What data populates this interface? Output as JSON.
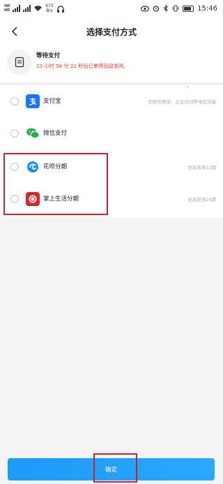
{
  "status_bar": {
    "sim1": "HD",
    "sim2": "HD",
    "speed_value": "675",
    "speed_unit": "B/s",
    "battery": "",
    "time": "15:46"
  },
  "nav": {
    "back_label": "‹",
    "title": "选择支付方式"
  },
  "order": {
    "title": "等待支付",
    "countdown": "23 小时 58 分 21 秒后订单将自动关闭。"
  },
  "payment_methods": [
    {
      "name": "支付宝",
      "tip": "勿轻信刷单、企业代付等电信诈骗",
      "icon": "alipay-icon",
      "color": "#1677ff"
    },
    {
      "name": "微信支付",
      "tip": "",
      "icon": "wechat-icon",
      "color": "#2aae4e"
    },
    {
      "name": "花呗分期",
      "tip": "至高支持12期",
      "icon": "huabei-icon",
      "color": "#1b8ef0"
    },
    {
      "name": "掌上生活分期",
      "tip": "至高支持24期",
      "icon": "zhangshang-icon",
      "color": "#d9242f"
    }
  ],
  "confirm": {
    "label": "确定"
  },
  "colors": {
    "accent": "#1b9af7",
    "highlight": "#c8242f",
    "countdown": "#e3332b"
  }
}
